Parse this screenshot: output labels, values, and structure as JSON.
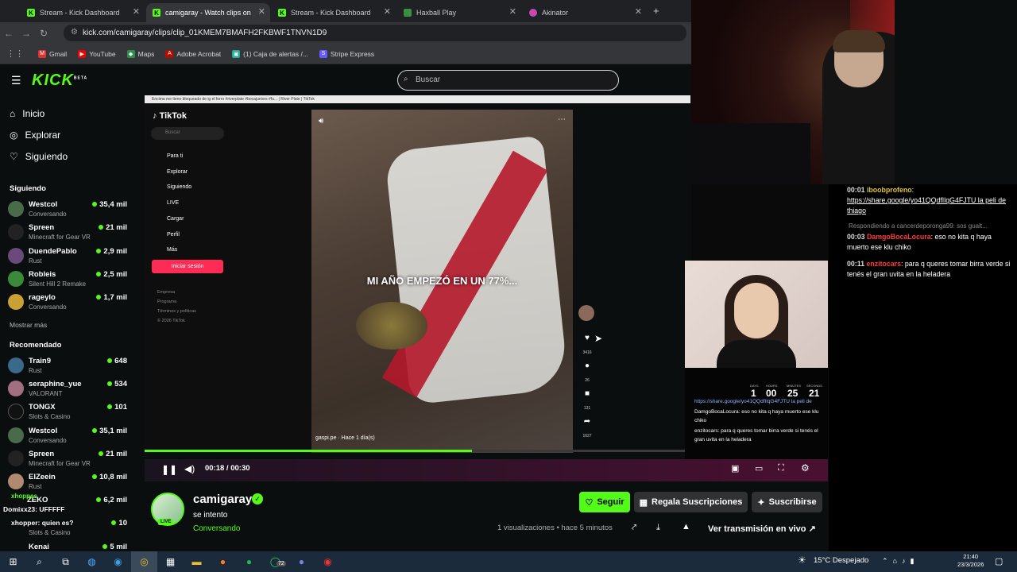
{
  "browser": {
    "tabs": [
      {
        "title": "Stream - Kick Dashboard",
        "active": false
      },
      {
        "title": "camigaray - Watch clips on",
        "active": true
      },
      {
        "title": "Stream - Kick Dashboard",
        "active": false
      },
      {
        "title": "Haxball Play",
        "active": false
      },
      {
        "title": "Akinator",
        "active": false
      }
    ],
    "url": "kick.com/camigaray/clips/clip_01KMEM7BMAFH2FKBWF1TNVN1D9",
    "bookmarks": [
      "Gmail",
      "YouTube",
      "Maps",
      "Adobe Acrobat",
      "(1) Caja de alertas /...",
      "Stripe Express"
    ]
  },
  "kick": {
    "logo": "KICK",
    "logo_badge": "BETA",
    "search_placeholder": "Buscar",
    "nav": [
      "Inicio",
      "Explorar",
      "Siguiendo"
    ],
    "following_title": "Siguiendo",
    "following": [
      {
        "name": "Westcol",
        "category": "Conversando",
        "viewers": "35,4 mil"
      },
      {
        "name": "Spreen",
        "category": "Minecraft for Gear VR",
        "viewers": "21 mil"
      },
      {
        "name": "DuendePablo",
        "category": "Rust",
        "viewers": "2,9 mil"
      },
      {
        "name": "Robleis",
        "category": "Silent Hill 2 Remake",
        "viewers": "2,5 mil"
      },
      {
        "name": "rageylo",
        "category": "Conversando",
        "viewers": "1,7 mil"
      }
    ],
    "show_more": "Mostrar más",
    "recommended_title": "Recomendado",
    "recommended": [
      {
        "name": "Train9",
        "category": "Rust",
        "viewers": "648"
      },
      {
        "name": "seraphine_yue",
        "category": "VALORANT",
        "viewers": "534"
      },
      {
        "name": "TONGX",
        "category": "Slots & Casino",
        "viewers": "101"
      },
      {
        "name": "Westcol",
        "category": "Conversando",
        "viewers": "35,1 mil"
      },
      {
        "name": "Spreen",
        "category": "Minecraft for Gear VR",
        "viewers": "21 mil"
      },
      {
        "name": "ElZeein",
        "category": "Rust",
        "viewers": "10,8 mil"
      },
      {
        "name": "ZEKO",
        "category": "",
        "viewers": "6,2 mil"
      },
      {
        "name": "",
        "category": "Slots & Casino",
        "viewers": "10"
      },
      {
        "name": "Kenai",
        "category": "",
        "viewers": "5 mil"
      }
    ]
  },
  "video": {
    "titlebar": "Encima me tiene bloqueado de ig el forro #riverplate #bocajuniors #fu... | River Plate | TikTok",
    "tiktok": {
      "brand": "TikTok",
      "search": "Buscar",
      "menu": [
        "Para ti",
        "Explorar",
        "Siguiendo",
        "LIVE",
        "Cargar",
        "Perfil",
        "Más"
      ],
      "login": "Iniciar sesión",
      "footer": [
        "Empresa",
        "Programa",
        "Términos y políticas",
        "© 2026 TikTok"
      ],
      "caption": "MI AÑO EMPEZÓ EN UN 77%...",
      "author": "gaspi.pe · Hace 1 día(s)",
      "counts": [
        "3416",
        "26",
        "131",
        "1627"
      ]
    },
    "time": "00:18 / 00:30",
    "progress": 0.6
  },
  "stream_overlay": {
    "countdown_labels": [
      "DAYS",
      "HOURS",
      "MINUTES",
      "SECONDS"
    ],
    "countdown": [
      "1",
      "00",
      "25",
      "21"
    ],
    "chat": [
      "https://share.google/yo41QQdfIlqG4FJTU la peli de",
      "DamgoBocaLocura: eso no kita q haya muerto ese klu chiko",
      "enzitocars: para q queres tomar birra verde si tenés el gran uvita en la heladera"
    ]
  },
  "chat": {
    "messages": [
      {
        "time": "00:01",
        "user": "iboobprofeno",
        "text": "https://share.google/yo41QQdfIlqG4FJTU la peli de thiago"
      },
      {
        "time": "00:03",
        "user": "DamgoBocaLocura",
        "text": "eso no kita q haya muerto ese klu chiko",
        "reply": "Respondiendo a cancerdeporonga99: sos gualt..."
      },
      {
        "time": "00:11",
        "user": "enzitocars",
        "text": "para q queres tomar birra verde si tenés el gran uvita en la heladera"
      }
    ]
  },
  "stream_info": {
    "streamer": "camigaray",
    "live_badge": "LIVE",
    "title": "se intento",
    "category": "Conversando",
    "follow": "Seguir",
    "gift": "Regala Suscripciones",
    "subscribe": "Suscribirse",
    "views": "1 visualizaciones • hace 5 minutos",
    "watch_live": "Ver transmisión en vivo"
  },
  "overlay_text": [
    "xhoppes",
    "Domixx23: UFFFFF",
    "xhopper: quien es?"
  ],
  "taskbar": {
    "weather": "15°C Despejado",
    "time": "21:40",
    "date": "23/3/2026",
    "badge": "72"
  },
  "colors": {
    "kick_green": "#53fc18",
    "background": "#0b0e0f",
    "taskbar": "#1c2b3b"
  }
}
